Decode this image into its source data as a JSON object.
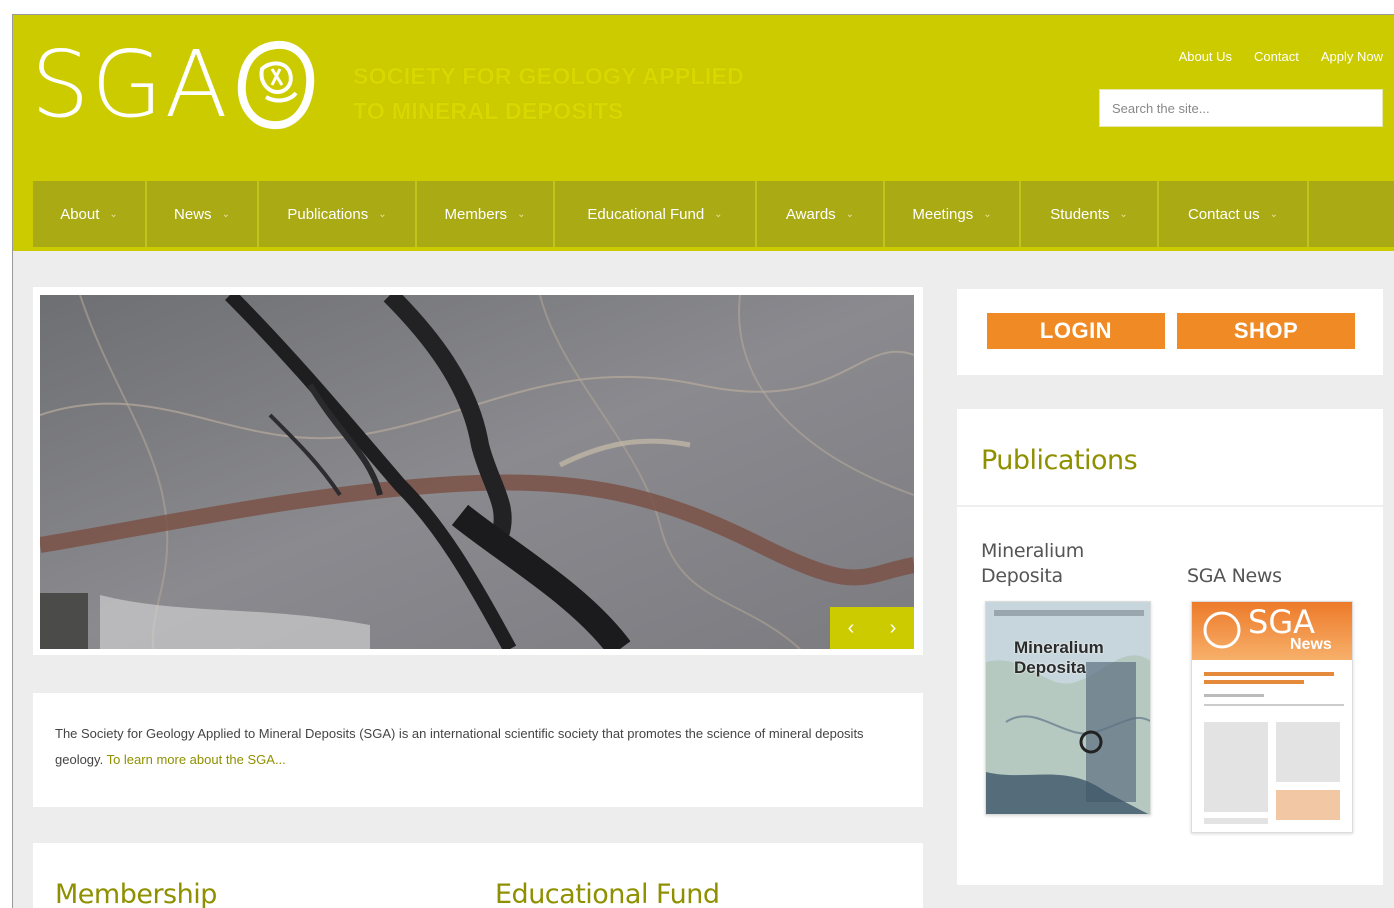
{
  "header": {
    "logo_text": "SGA",
    "tagline_line1": "SOCIETY FOR GEOLOGY APPLIED",
    "tagline_line2": "TO MINERAL DEPOSITS",
    "top_links": [
      "About Us",
      "Contact",
      "Apply Now"
    ],
    "search_placeholder": "Search the site..."
  },
  "nav": {
    "items": [
      "About",
      "News",
      "Publications",
      "Members",
      "Educational Fund",
      "Awards",
      "Meetings",
      "Students",
      "Contact us"
    ]
  },
  "slider": {
    "prev_icon": "chevron-left-icon",
    "next_icon": "chevron-right-icon",
    "prev_glyph": "‹",
    "next_glyph": "›"
  },
  "intro": {
    "text": "The Society for Geology Applied to Mineral Deposits (SGA) is an international scientific society that promotes the science of mineral deposits geology.",
    "link": "To learn more about the SGA..."
  },
  "sections": {
    "membership": "Membership",
    "educational_fund": "Educational Fund"
  },
  "buttons": {
    "login": "LOGIN",
    "shop": "SHOP"
  },
  "publications": {
    "title": "Publications",
    "mineralium_line1": "Mineralium",
    "mineralium_line2": "Deposita",
    "sga_news": "SGA News",
    "md_cover_title_line1": "Mineralium",
    "md_cover_title_line2": "Deposita",
    "news_cover_logo": "SGA",
    "news_cover_sub": "News"
  },
  "colors": {
    "brand": "#cccb00",
    "nav": "#a9aa14",
    "accent_text": "#8f9000",
    "button": "#f08a24"
  }
}
